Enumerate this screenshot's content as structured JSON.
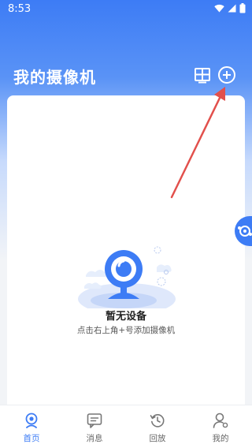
{
  "status_bar": {
    "time": "8:53"
  },
  "header": {
    "title": "我的摄像机"
  },
  "empty_state": {
    "title": "暂无设备",
    "hint": "点击右上角+号添加摄像机"
  },
  "tabs": [
    {
      "label": "首页",
      "icon": "home-camera-icon",
      "active": true
    },
    {
      "label": "消息",
      "icon": "message-icon",
      "active": false
    },
    {
      "label": "回放",
      "icon": "playback-clock-icon",
      "active": false
    },
    {
      "label": "我的",
      "icon": "profile-icon",
      "active": false
    }
  ],
  "colors": {
    "accent": "#3d7cf5",
    "annotation_arrow": "#e2504c"
  }
}
